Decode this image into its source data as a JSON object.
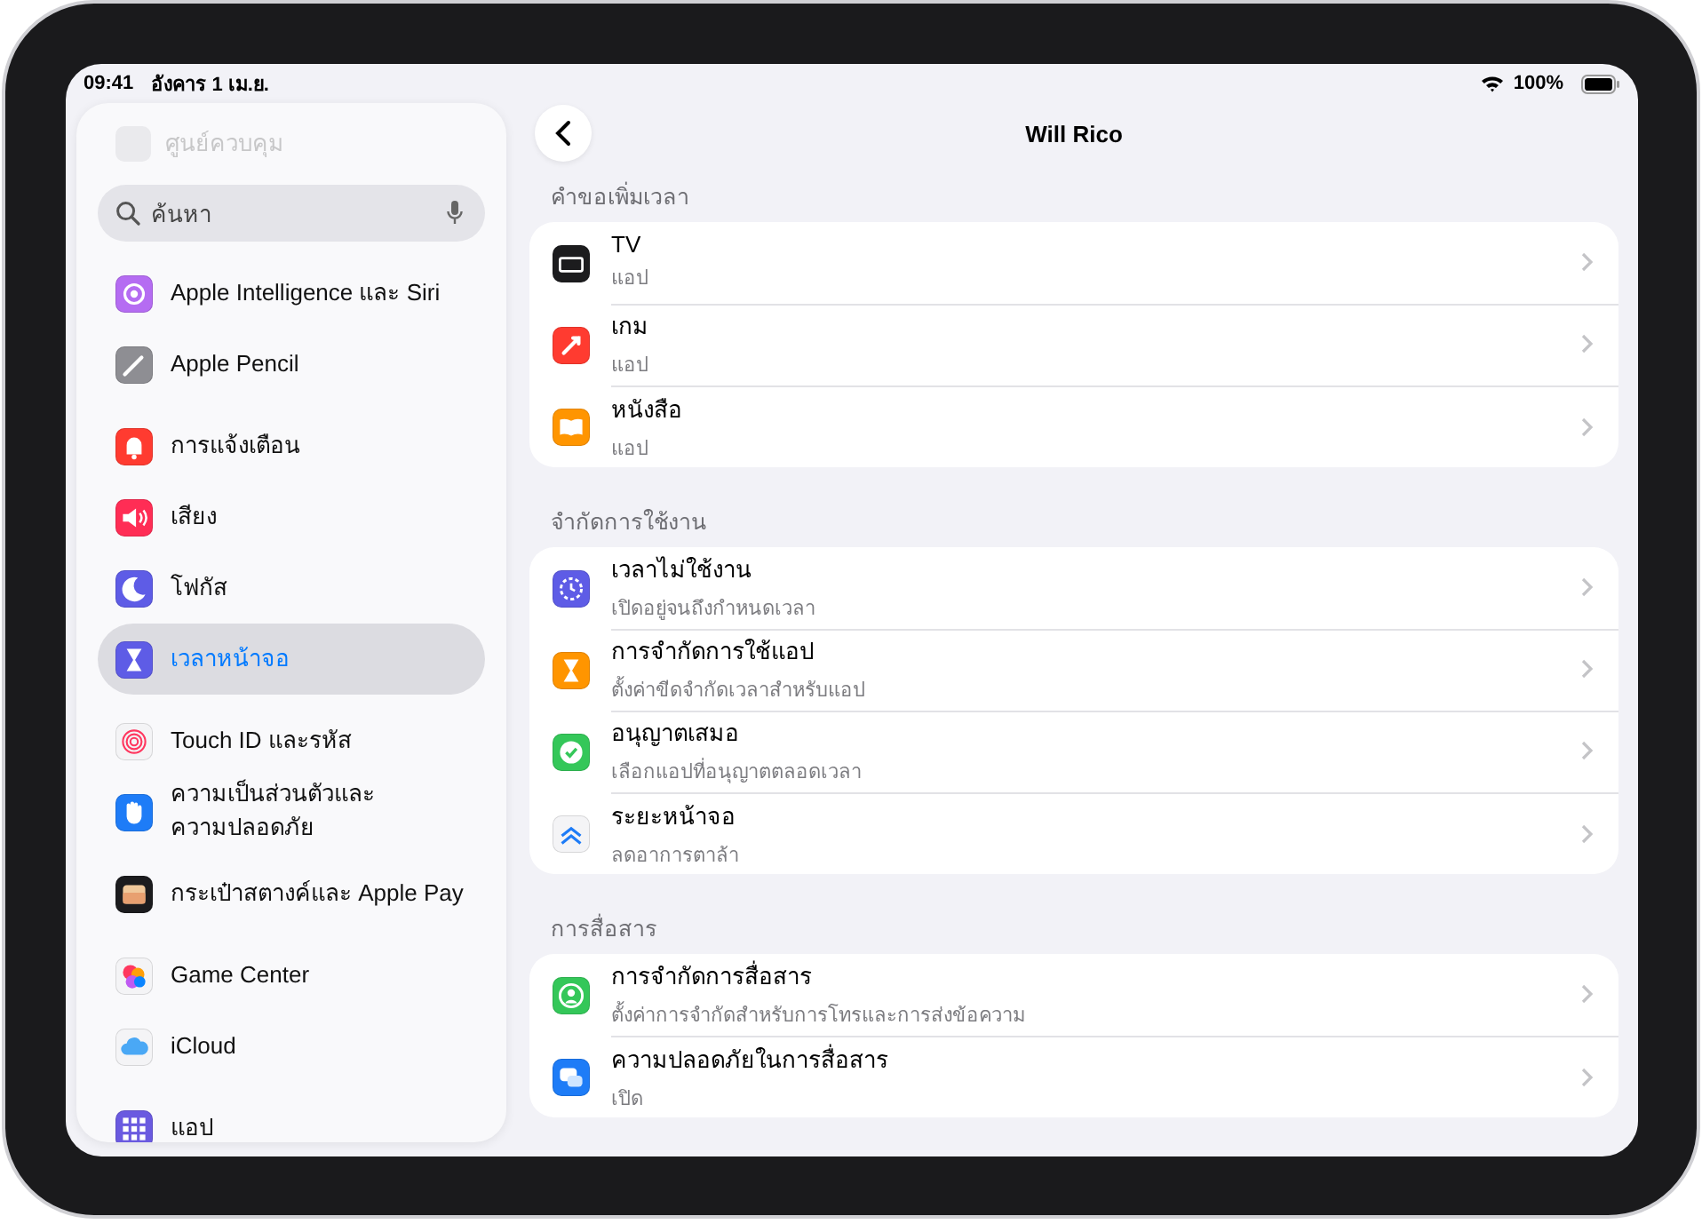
{
  "status_bar": {
    "time": "09:41",
    "date": "อังคาร 1 เม.ย.",
    "battery": "100%"
  },
  "sidebar": {
    "faded_item": {
      "label": "ศูนย์ควบคุม"
    },
    "search": {
      "placeholder": "ค้นหา"
    },
    "groups": [
      {
        "items": [
          {
            "label": "Apple Intelligence และ Siri",
            "color": "#b56cf2",
            "selected": false
          },
          {
            "label": "Apple Pencil",
            "color": "#8e8e93",
            "selected": false
          }
        ]
      },
      {
        "items": [
          {
            "label": "การแจ้งเตือน",
            "color": "#ff3b30",
            "selected": false
          },
          {
            "label": "เสียง",
            "color": "#ff2d55",
            "selected": false
          },
          {
            "label": "โฟกัส",
            "color": "#5e5ce6",
            "selected": false
          },
          {
            "label": "เวลาหน้าจอ",
            "color": "#5e5ce6",
            "selected": true
          }
        ]
      },
      {
        "items": [
          {
            "label": "Touch ID และรหัส",
            "color": "#f4f4f6",
            "selected": false
          },
          {
            "label": "ความเป็นส่วนตัวและ\nความปลอดภัย",
            "color": "#1e7cf7",
            "selected": false
          }
        ]
      },
      {
        "items": [
          {
            "label": "กระเป๋าสตางค์และ Apple Pay",
            "color": "#1c1c1e",
            "selected": false
          }
        ]
      },
      {
        "items": [
          {
            "label": "Game Center",
            "color": "#f4f4f6",
            "selected": false
          },
          {
            "label": "iCloud",
            "color": "#f4f4f6",
            "selected": false
          }
        ]
      },
      {
        "items": [
          {
            "label": "แอป",
            "color": "#6a5ae0",
            "selected": false
          }
        ]
      }
    ]
  },
  "detail": {
    "title": "Will Rico",
    "sections": [
      {
        "header": "คำขอเพิ่มเวลา",
        "rows": [
          {
            "title": "TV",
            "subtitle": "แอป",
            "color": "#1c1c1e"
          },
          {
            "title": "เกม",
            "subtitle": "แอป",
            "color": "#ff3b30"
          },
          {
            "title": "หนังสือ",
            "subtitle": "แอป",
            "color": "#ff9500"
          }
        ]
      },
      {
        "header": "จำกัดการใช้งาน",
        "rows": [
          {
            "title": "เวลาไม่ใช้งาน",
            "subtitle": "เปิดอยู่จนถึงกำหนดเวลา",
            "color": "#5e5ce6"
          },
          {
            "title": "การจำกัดการใช้แอป",
            "subtitle": "ตั้งค่าขีดจำกัดเวลาสำหรับแอป",
            "color": "#ff9500"
          },
          {
            "title": "อนุญาตเสมอ",
            "subtitle": "เลือกแอปที่อนุญาตตลอดเวลา",
            "color": "#34c759"
          },
          {
            "title": "ระยะหน้าจอ",
            "subtitle": "ลดอาการตาล้า",
            "color": "#f4f4f6"
          }
        ]
      },
      {
        "header": "การสื่อสาร",
        "rows": [
          {
            "title": "การจำกัดการสื่อสาร",
            "subtitle": "ตั้งค่าการจำกัดสำหรับการโทรและการส่งข้อความ",
            "color": "#34c759"
          },
          {
            "title": "ความปลอดภัยในการสื่อสาร",
            "subtitle": "เปิด",
            "color": "#1e7cf7"
          }
        ]
      }
    ]
  }
}
